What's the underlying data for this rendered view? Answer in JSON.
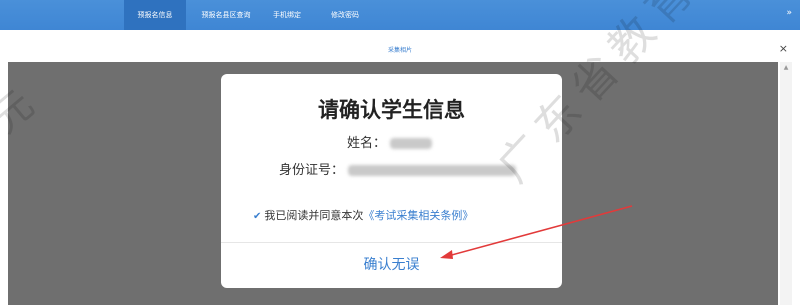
{
  "nav": {
    "tabs": [
      {
        "label": "预报名信息",
        "active": true
      },
      {
        "label": "预报名县区查询",
        "active": false
      },
      {
        "label": "手机绑定",
        "active": false
      },
      {
        "label": "修改密码",
        "active": false
      }
    ],
    "right_icon": "double-arrow-right-icon"
  },
  "outer_dialog": {
    "title": "采集相片",
    "close_label": "×"
  },
  "modal": {
    "title": "请确认学生信息",
    "name_label": "姓名：",
    "id_label": "身份证号：",
    "agree_text": "我已阅读并同意本次",
    "agree_link": "《考试采集相关条例》",
    "agree_checked": true,
    "confirm_label": "确认无误"
  },
  "watermark": {
    "main": "广东省教育",
    "left": "元"
  },
  "colors": {
    "nav_bg": "#4a90d9",
    "nav_active": "#2f72bf",
    "accent": "#3a7fcf",
    "overlay": "#6f6f6f",
    "arrow": "#e23a3a"
  }
}
